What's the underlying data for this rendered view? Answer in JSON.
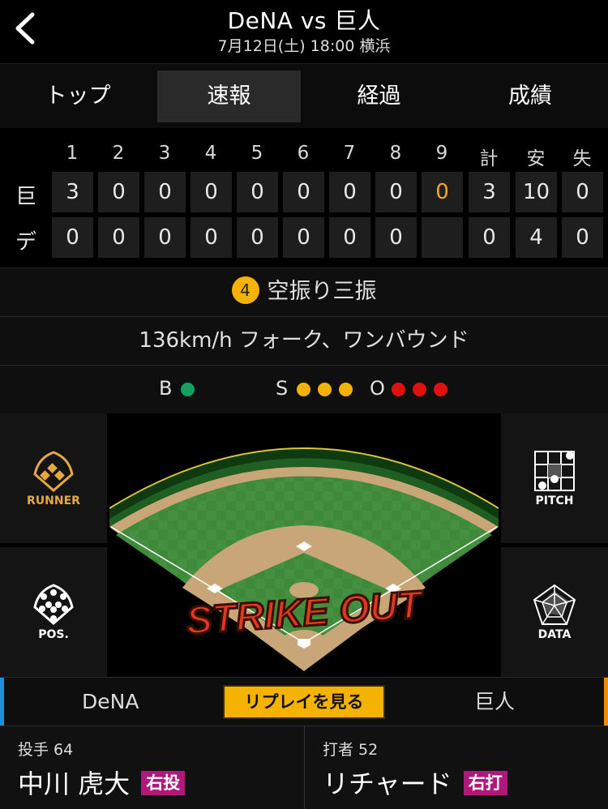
{
  "header": {
    "title": "DeNA vs 巨人",
    "subtitle": "7月12日(土) 18:00 横浜"
  },
  "tabs": [
    "トップ",
    "速報",
    "経過",
    "成績"
  ],
  "active_tab": "速報",
  "scoreboard": {
    "columns": [
      "1",
      "2",
      "3",
      "4",
      "5",
      "6",
      "7",
      "8",
      "9",
      "計",
      "安",
      "失"
    ],
    "teams": [
      {
        "name": "巨",
        "cells": [
          "3",
          "0",
          "0",
          "0",
          "0",
          "0",
          "0",
          "0",
          "0",
          "3",
          "10",
          "0"
        ]
      },
      {
        "name": "デ",
        "cells": [
          "0",
          "0",
          "0",
          "0",
          "0",
          "0",
          "0",
          "0",
          "",
          "0",
          "4",
          "0"
        ]
      }
    ]
  },
  "play": {
    "batter_num": "4",
    "result": "空振り三振"
  },
  "pitch_info": "136km/h フォーク、ワンバウンド",
  "count": {
    "balls_label": "B",
    "strikes_label": "S",
    "outs_label": "O",
    "balls": 1,
    "strikes": 3,
    "outs": 3
  },
  "colors": {
    "ball": "#14a060",
    "strike": "#f5b300",
    "out": "#e01010",
    "accent": "#f5b300",
    "dena": "#1e90d6",
    "giants": "#f08c00"
  },
  "buttons": {
    "runner": "RUNNER",
    "pitch": "PITCH",
    "pos": "POS.",
    "data": "DATA"
  },
  "field_overlay": "STRIKE OUT",
  "teambar": {
    "left_team": "DeNA",
    "replay": "リプレイを見る",
    "right_team": "巨人"
  },
  "pitcher": {
    "role": "投手 64",
    "name": "中川 虎大",
    "hand": "右投"
  },
  "batter": {
    "role": "打者 52",
    "name": "リチャード",
    "hand": "右打"
  }
}
